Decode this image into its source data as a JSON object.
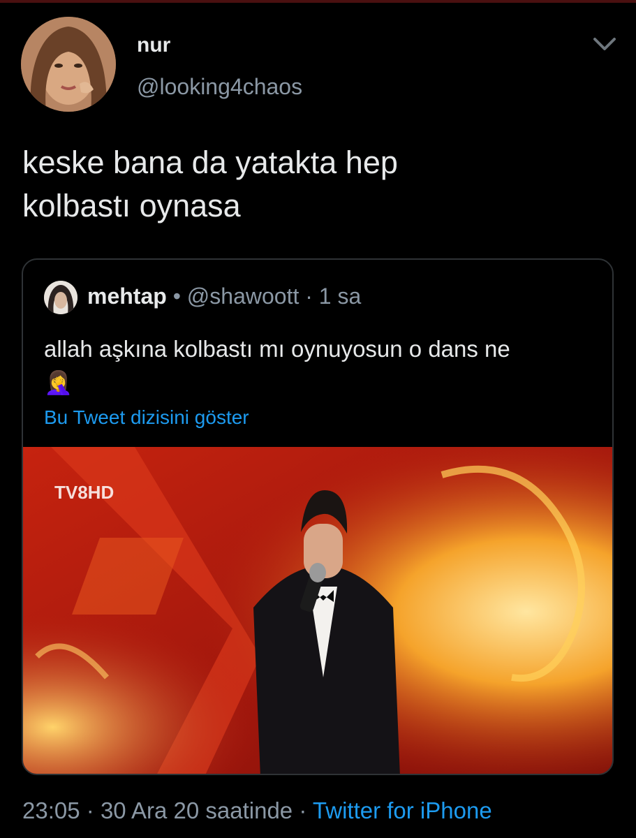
{
  "tweet": {
    "author": {
      "display_name": "nur",
      "handle": "@looking4chaos",
      "avatar_icon": "profile-photo"
    },
    "text_line1": "keske bana da yatakta hep",
    "text_line2": "kolbastı oynasa",
    "menu_icon": "chevron-down-icon",
    "time": "23:05",
    "date": "30 Ara 20 saatinde",
    "separator": "·",
    "source": "Twitter for iPhone"
  },
  "quoted_tweet": {
    "display_name": "mehtap",
    "name_dot": "•",
    "handle": "@shawoott",
    "separator": "·",
    "time_ago": "1 sa",
    "text_line1": "allah aşkına kolbastı mı oynuyosun o dans ne",
    "text_line2": "🤦‍♀️",
    "show_thread_label": "Bu Tweet dizisini göster",
    "media": {
      "type": "video-still",
      "watermark": "TV8HD"
    }
  },
  "colors": {
    "background": "#000000",
    "primary_text": "#e7e9ea",
    "secondary_text": "#8b98a5",
    "link": "#1d9bf0",
    "card_border": "#2f3336",
    "media_red": "#b51d10"
  }
}
